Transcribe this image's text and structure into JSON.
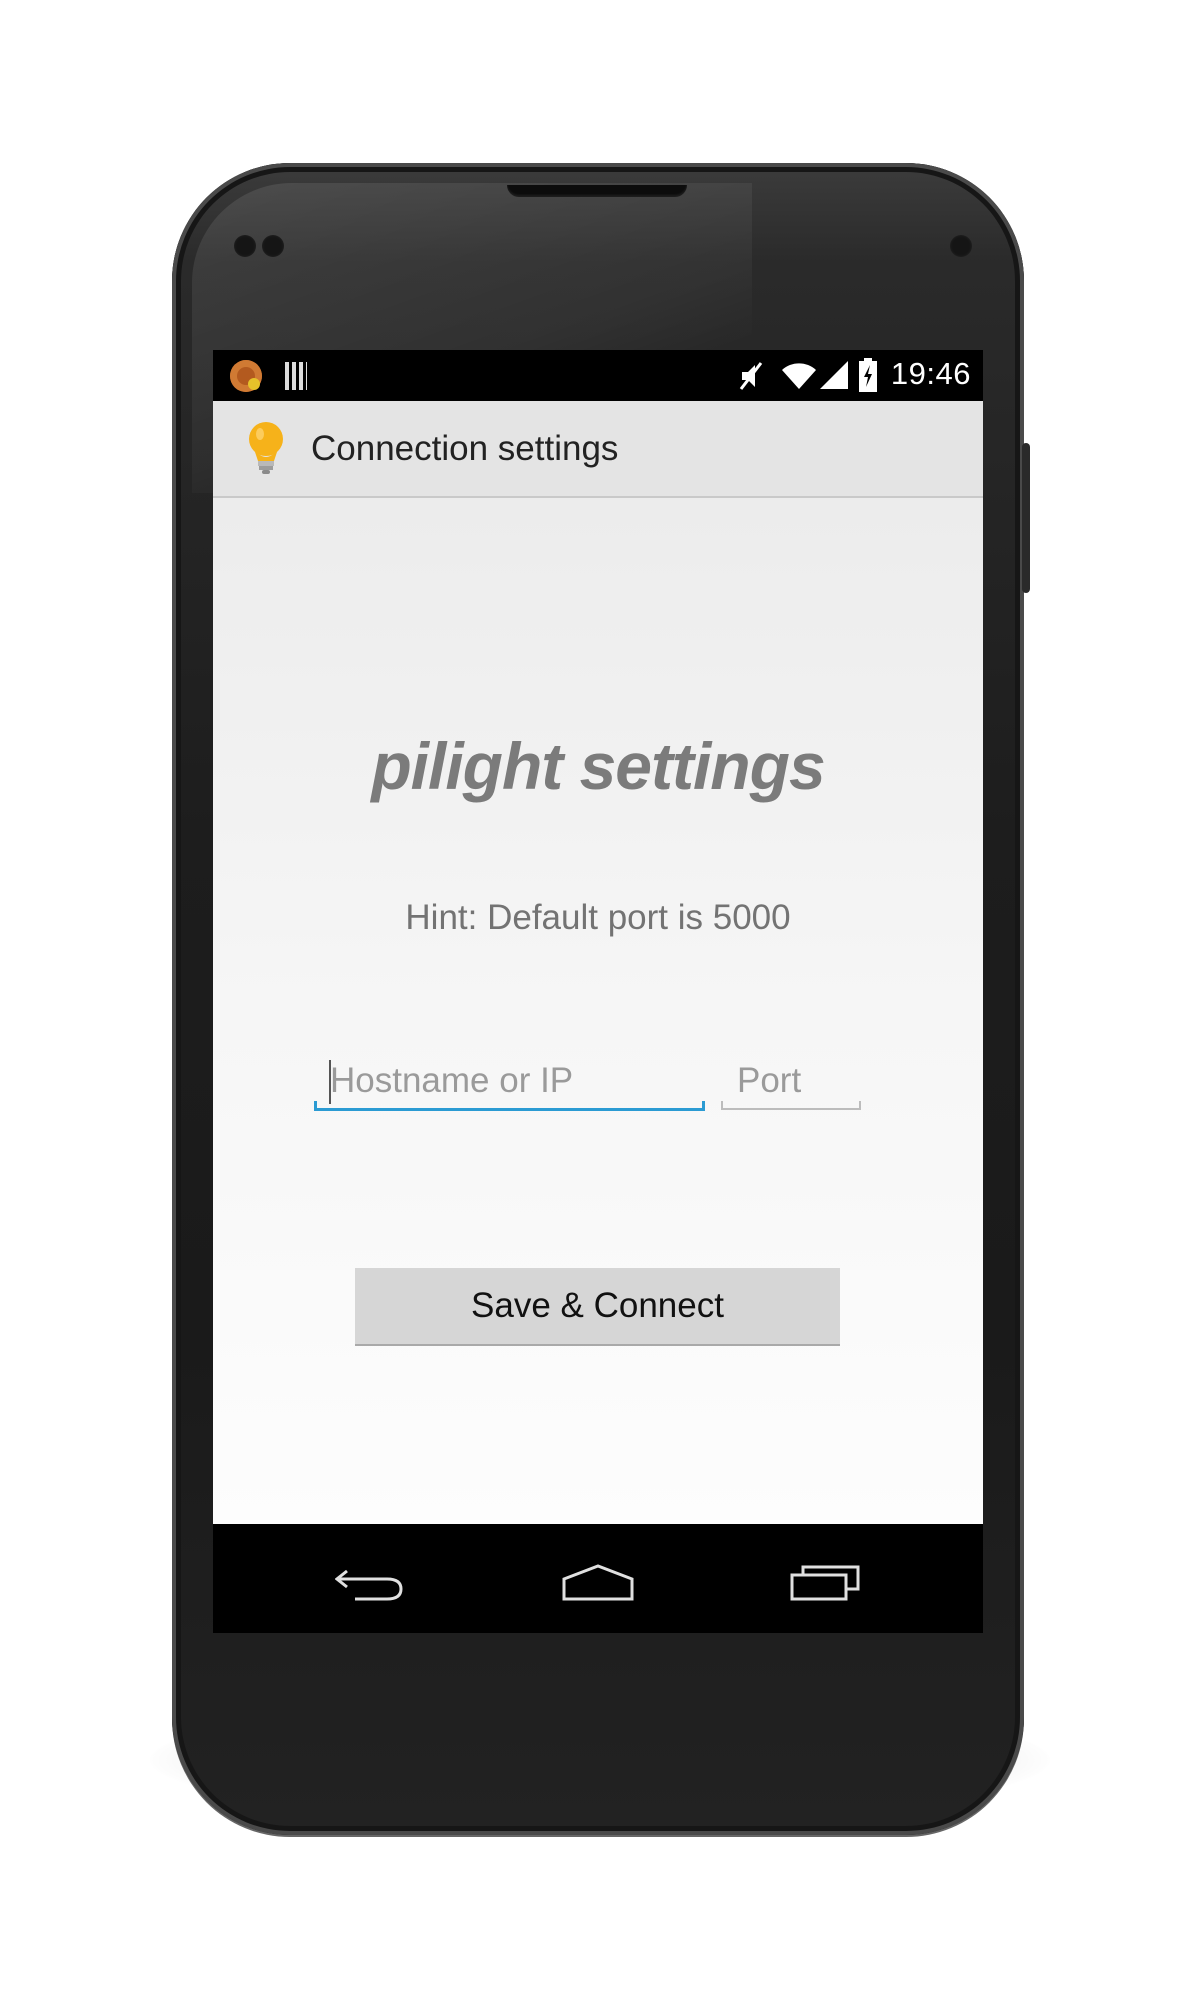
{
  "status_bar": {
    "time": "19:46",
    "icons": [
      "notification-app-icon",
      "storage-icon",
      "mute-icon",
      "wifi-icon",
      "signal-icon",
      "battery-charging-icon"
    ]
  },
  "action_bar": {
    "icon": "lightbulb-icon",
    "title": "Connection settings"
  },
  "main": {
    "heading": "pilight settings",
    "hint": "Hint: Default port is 5000",
    "hostname_field": {
      "value": "",
      "placeholder": "Hostname or IP"
    },
    "port_field": {
      "value": "",
      "placeholder": "Port"
    },
    "save_button_label": "Save & Connect"
  },
  "nav_bar": {
    "icons": [
      "back-icon",
      "home-icon",
      "recents-icon"
    ]
  },
  "colors": {
    "focus_accent": "#2b9bd3",
    "action_bar_bg": "#e4e4e4",
    "button_bg": "#d6d6d6",
    "heading_text": "#7b7b7b"
  }
}
